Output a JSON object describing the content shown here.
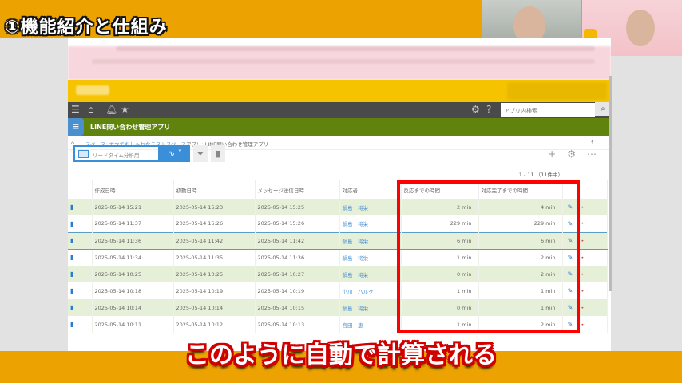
{
  "overlay": {
    "section_title": "①機能紹介と仕組み",
    "caption": "このように自動で計算される"
  },
  "nav": {
    "search_placeholder": "アプリ内検索"
  },
  "app": {
    "title": "LINE問い合わせ管理アプリ"
  },
  "breadcrumb": {
    "space": "スペース: ナウでおしゃれなテストスペース",
    "app": "アプリ: LINE問い合わせ管理アプリ"
  },
  "toolbar": {
    "view": "リードタイム分析用"
  },
  "count": "1 - 11 （11件中）",
  "table": {
    "headers": [
      "作成日時",
      "初動日時",
      "メッセージ送信日時",
      "対応者",
      "反応までの時間",
      "対応完了までの時間"
    ],
    "rows": [
      [
        "2025-05-14 15:21",
        "2025-05-14 15:23",
        "2025-05-14 15:25",
        "鍋島　将栄",
        "2 min",
        "4 min"
      ],
      [
        "2025-05-14 11:37",
        "2025-05-14 15:26",
        "2025-05-14 15:26",
        "鍋島　将栄",
        "229 min",
        "229 min"
      ],
      [
        "2025-05-14 11:36",
        "2025-05-14 11:42",
        "2025-05-14 11:42",
        "鍋島　将栄",
        "6 min",
        "6 min"
      ],
      [
        "2025-05-14 11:34",
        "2025-05-14 11:35",
        "2025-05-14 11:36",
        "鍋島　将栄",
        "1 min",
        "2 min"
      ],
      [
        "2025-05-14 10:25",
        "2025-05-14 10:25",
        "2025-05-14 10:27",
        "鍋島　将栄",
        "0 min",
        "2 min"
      ],
      [
        "2025-05-14 10:18",
        "2025-05-14 10:19",
        "2025-05-14 10:19",
        "小川　ハルク",
        "1 min",
        "1 min"
      ],
      [
        "2025-05-14 10:14",
        "2025-05-14 10:14",
        "2025-05-14 10:15",
        "鍋島　将栄",
        "0 min",
        "1 min"
      ],
      [
        "2025-05-14 10:11",
        "2025-05-14 10:12",
        "2025-05-14 10:13",
        "宮田　恵",
        "1 min",
        "2 min"
      ]
    ]
  }
}
